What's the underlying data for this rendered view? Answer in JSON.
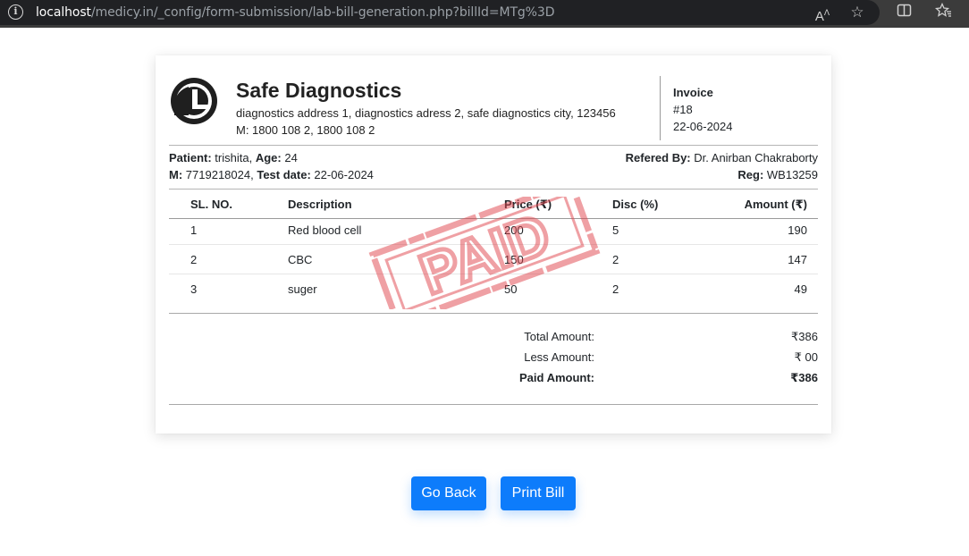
{
  "browser": {
    "url_host": "localhost",
    "url_path": "/medicy.in/_config/form-submission/lab-bill-generation.php?billId=MTg%3D"
  },
  "company": {
    "name": "Safe Diagnostics",
    "address": "diagnostics address 1, diagnostics adress 2, safe diagnostics city, 123456",
    "phone": "M: 1800 108 2, 1800 108 2"
  },
  "invoice": {
    "label": "Invoice",
    "number": "#18",
    "date": "22-06-2024"
  },
  "patient": {
    "name_label": "Patient:",
    "name": "trishita",
    "age_label": "Age:",
    "age": "24",
    "mobile_label": "M:",
    "mobile": "7719218024",
    "test_date_label": "Test date:",
    "test_date": "22-06-2024",
    "refered_by_label": "Refered By:",
    "refered_by": "Dr. Anirban Chakraborty",
    "reg_label": "Reg:",
    "reg": "WB13259"
  },
  "table": {
    "headers": {
      "sl": "SL. NO.",
      "description": "Description",
      "price": "Price (₹)",
      "disc": "Disc (%)",
      "amount": "Amount (₹)"
    },
    "rows": [
      {
        "sl": "1",
        "description": "Red blood cell",
        "price": "200",
        "disc": "5",
        "amount": "190"
      },
      {
        "sl": "2",
        "description": "CBC",
        "price": "150",
        "disc": "2",
        "amount": "147"
      },
      {
        "sl": "3",
        "description": "suger",
        "price": "50",
        "disc": "2",
        "amount": "49"
      }
    ]
  },
  "totals": {
    "total_label": "Total Amount:",
    "total_value": "₹386",
    "less_label": "Less Amount:",
    "less_value": "₹ 00",
    "paid_label": "Paid Amount:",
    "paid_value": "₹386"
  },
  "stamp": {
    "text": "PAID",
    "color": "#e0434b"
  },
  "buttons": {
    "go_back": "Go Back",
    "print_bill": "Print Bill"
  },
  "colors": {
    "primary": "#0d7cfb"
  }
}
